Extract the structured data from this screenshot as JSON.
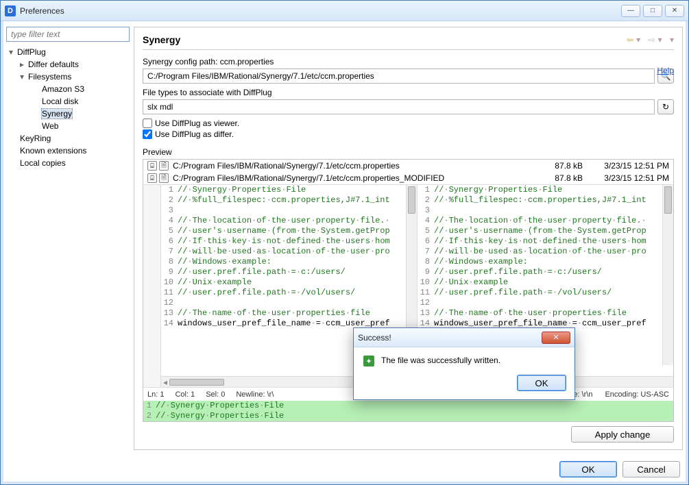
{
  "window": {
    "title": "Preferences",
    "icon_letter": "D"
  },
  "filter_placeholder": "type filter text",
  "tree": {
    "root": "DiffPlug",
    "items": [
      "Differ defaults",
      "Filesystems",
      "Amazon S3",
      "Local disk",
      "Synergy",
      "Web",
      "KeyRing",
      "Known extensions",
      "Local copies"
    ]
  },
  "panel": {
    "title": "Synergy",
    "help_label": "Help",
    "config_label": "Synergy config path: ccm.properties",
    "config_value": "C:/Program Files/IBM/Rational/Synergy/7.1/etc/ccm.properties",
    "assoc_label": "File types to associate with DiffPlug",
    "assoc_value": "slx mdl",
    "viewer_label": "Use DiffPlug as viewer.",
    "differ_label": "Use DiffPlug as differ.",
    "preview_label": "Preview",
    "files": [
      {
        "path": "C:/Program Files/IBM/Rational/Synergy/7.1/etc/ccm.properties",
        "size": "87.8 kB",
        "date": "3/23/15 12:51 PM"
      },
      {
        "path": "C:/Program Files/IBM/Rational/Synergy/7.1/etc/ccm.properties_MODIFIED",
        "size": "87.8 kB",
        "date": "3/23/15 12:51 PM"
      }
    ],
    "code_left": [
      "//·Synergy·Properties·File",
      "//·%full_filespec:·ccm.properties,J#7.1_int",
      "",
      "//·The·location·of·the·user·property·file.·",
      "//·user's·username·(from·the·System.getProp",
      "//·If·this·key·is·not·defined·the·users·hom",
      "//·will·be·used·as·location·of·the·user·pro",
      "//·Windows·example:",
      "//·user.pref.file.path·=·c:/users/",
      "//·Unix·example",
      "//·user.pref.file.path·=·/vol/users/",
      "",
      "//·The·name·of·the·user·properties·file",
      "windows_user_pref_file_name·=·ccm_user_pref"
    ],
    "code_right": [
      "//·Synergy·Properties·File",
      "//·%full_filespec:·ccm.properties,J#7.1_int",
      "",
      "//·The·location·of·the·user·property·file.·",
      "//·user's·username·(from·the·System.getProp",
      "//·If·this·key·is·not·defined·the·users·hom",
      "//·will·be·used·as·location·of·the·user·pro",
      "//·Windows·example:",
      "//·user.pref.file.path·=·c:/users/",
      "//·Unix·example",
      "//·user.pref.file.path·=·/vol/users/",
      "",
      "//·The·name·of·the·user·properties·file",
      "windows_user_pref_file_name·=·ccm_user_pref"
    ],
    "merged": [
      "//·Synergy·Properties·File",
      "//·Synergy·Properties·File"
    ],
    "status_left": {
      "ln": "Ln: 1",
      "col": "Col: 1",
      "sel": "Sel: 0",
      "newline": "Newline: \\r\\"
    },
    "status_right": {
      "newline": "ne: \\r\\n",
      "encoding": "Encoding: US-ASC"
    },
    "apply_label": "Apply change"
  },
  "footer": {
    "ok": "OK",
    "cancel": "Cancel"
  },
  "dialog": {
    "title": "Success!",
    "message": "The file was successfully written.",
    "ok": "OK"
  }
}
